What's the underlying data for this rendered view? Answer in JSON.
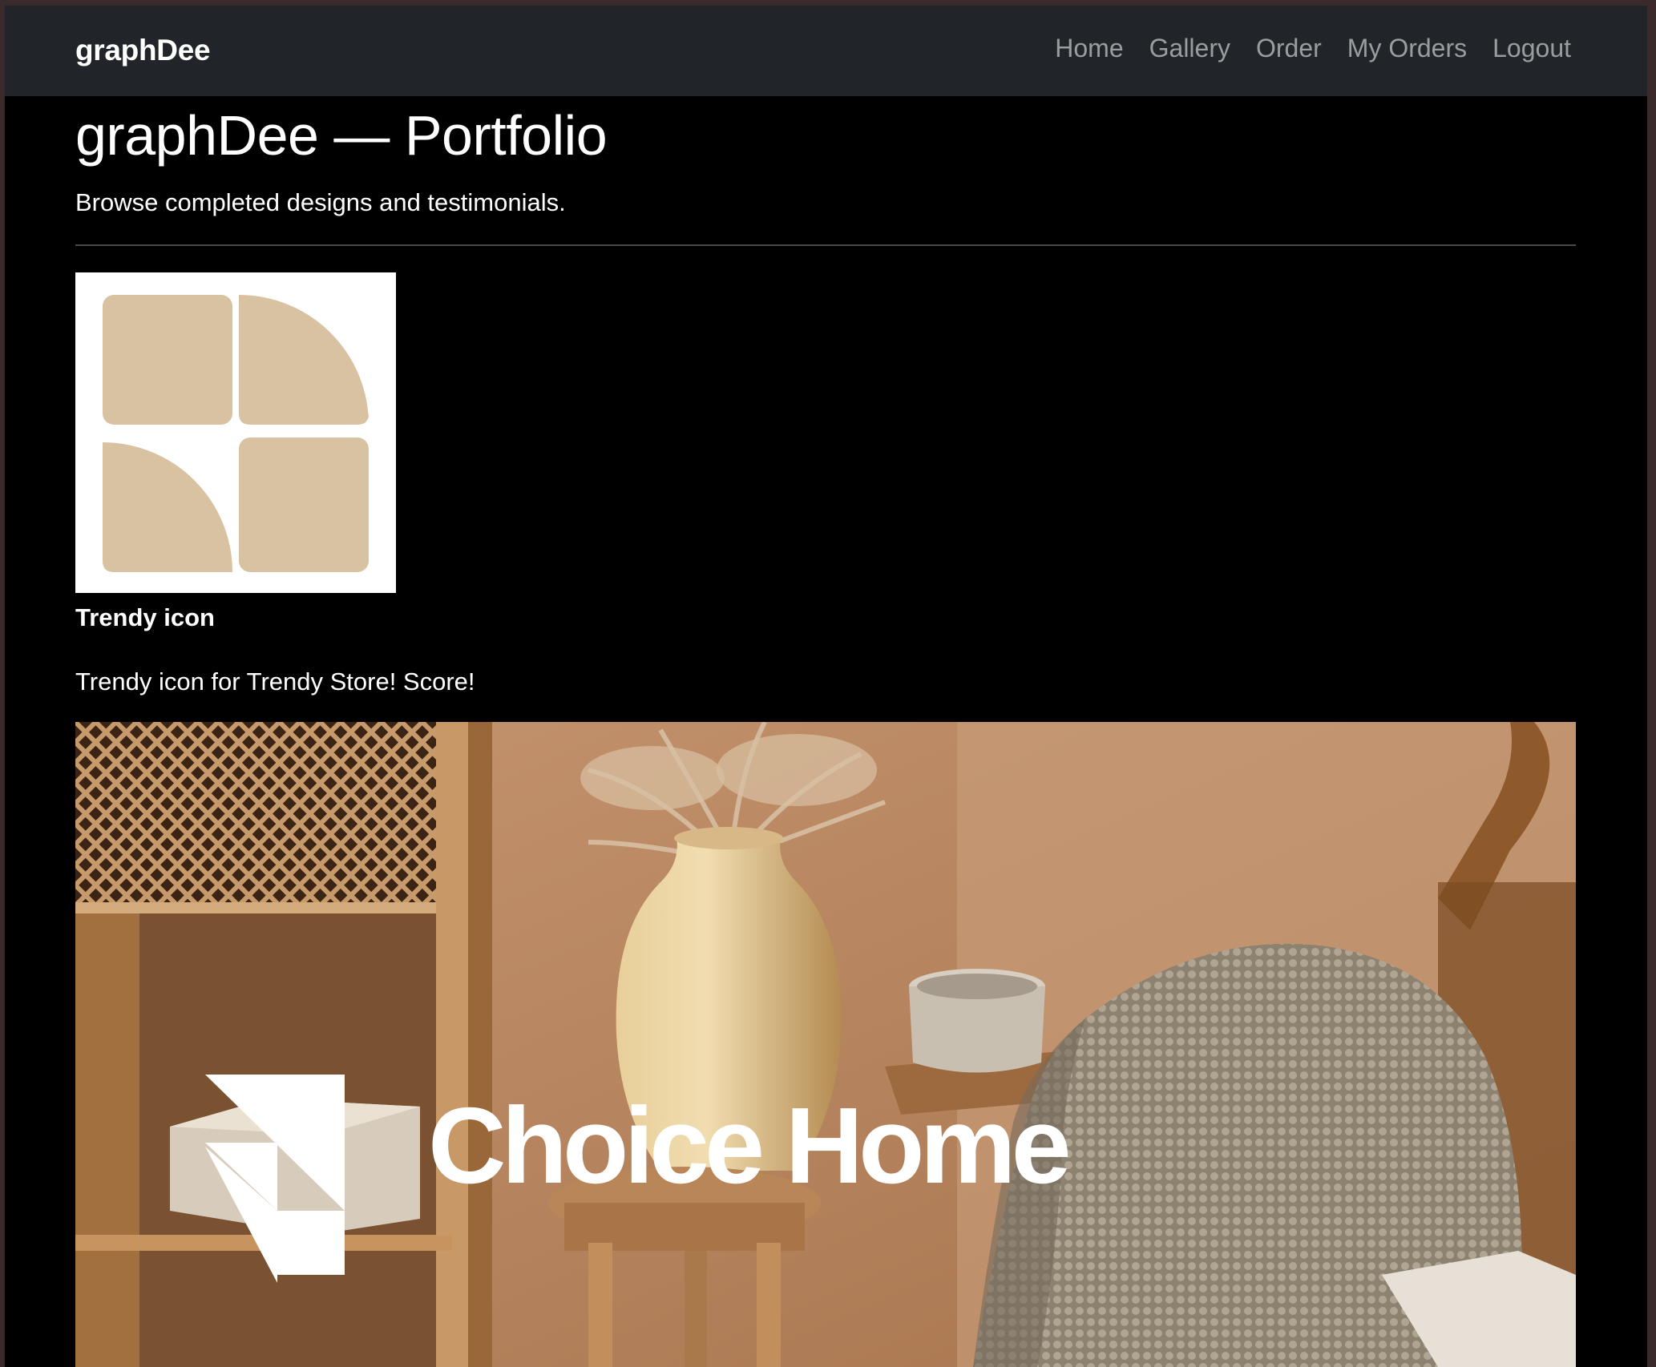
{
  "navbar": {
    "brand": "graphDee",
    "links": [
      {
        "label": "Home"
      },
      {
        "label": "Gallery"
      },
      {
        "label": "Order"
      },
      {
        "label": "My Orders"
      },
      {
        "label": "Logout"
      }
    ]
  },
  "page": {
    "title": "graphDee — Portfolio",
    "subtitle": "Browse completed designs and testimonials."
  },
  "items": [
    {
      "title": "Trendy icon",
      "description": "Trendy icon for Trendy Store! Score!",
      "icon": "trendy-store-logo",
      "accent": "#D9C2A1"
    },
    {
      "image_text": "Choice Home",
      "icon": "choice-home-logo"
    }
  ],
  "colors": {
    "navbar_bg": "#212529",
    "page_bg": "#000000",
    "text": "#ffffff",
    "nav_link": "#a6a8aa"
  }
}
